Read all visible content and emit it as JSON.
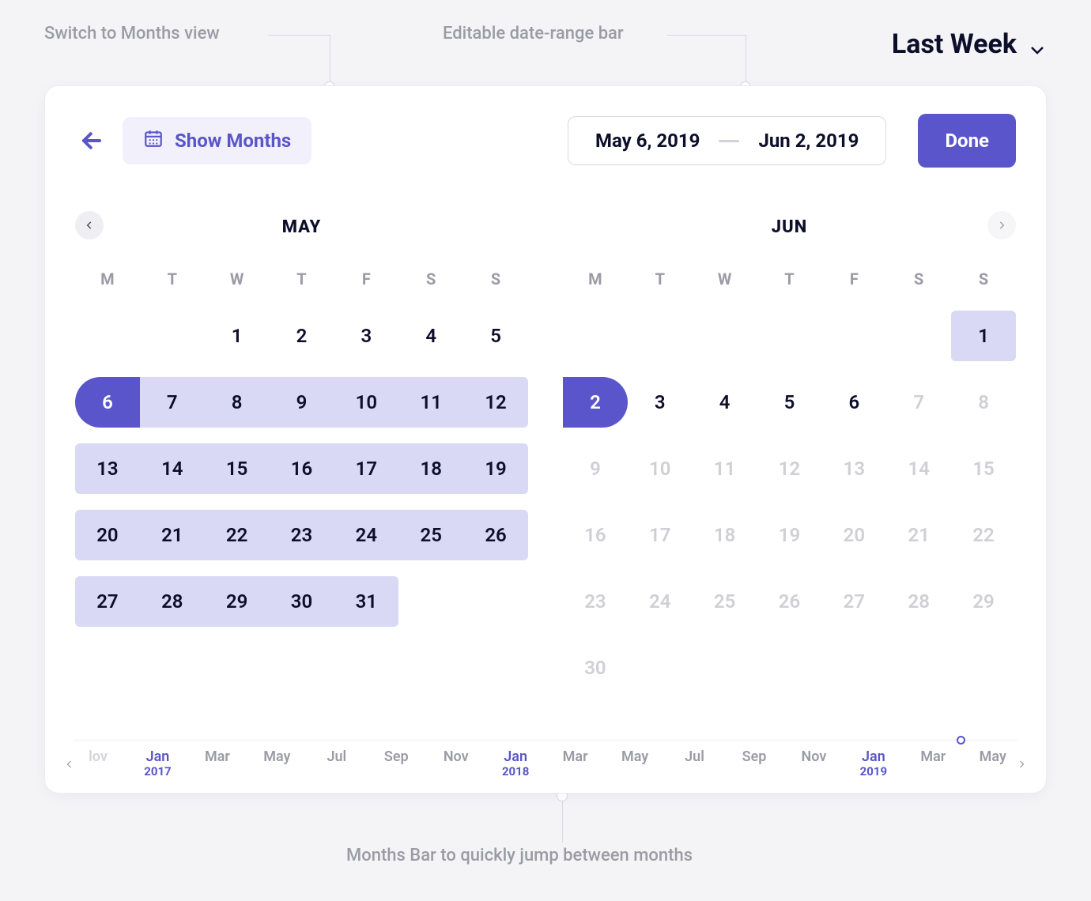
{
  "annotations": {
    "switch": "Switch to Months view",
    "bar": "Editable date-range bar",
    "months": "Months Bar to quickly jump between months"
  },
  "preset": {
    "label": "Last Week"
  },
  "toolbar": {
    "show_months": "Show Months",
    "range_from": "May 6, 2019",
    "range_to": "Jun 2, 2019",
    "done": "Done"
  },
  "weekdays": [
    "M",
    "T",
    "W",
    "T",
    "F",
    "S",
    "S"
  ],
  "selection": {
    "start_iso": "2019-05-06",
    "end_iso": "2019-06-02"
  },
  "months": [
    {
      "key": "may",
      "title": "MAY",
      "nav_prev": true,
      "nav_next": false,
      "days": [
        {
          "t": "empty"
        },
        {
          "t": "empty"
        },
        {
          "t": "n",
          "n": 1
        },
        {
          "t": "n",
          "n": 2
        },
        {
          "t": "n",
          "n": 3
        },
        {
          "t": "n",
          "n": 4
        },
        {
          "t": "n",
          "n": 5
        },
        {
          "t": "n",
          "n": 6,
          "sel": true,
          "cap": "start",
          "row_start": true
        },
        {
          "t": "n",
          "n": 7,
          "sel": true
        },
        {
          "t": "n",
          "n": 8,
          "sel": true
        },
        {
          "t": "n",
          "n": 9,
          "sel": true
        },
        {
          "t": "n",
          "n": 10,
          "sel": true
        },
        {
          "t": "n",
          "n": 11,
          "sel": true
        },
        {
          "t": "n",
          "n": 12,
          "sel": true,
          "row_end": true
        },
        {
          "t": "n",
          "n": 13,
          "sel": true,
          "row_start": true
        },
        {
          "t": "n",
          "n": 14,
          "sel": true
        },
        {
          "t": "n",
          "n": 15,
          "sel": true
        },
        {
          "t": "n",
          "n": 16,
          "sel": true
        },
        {
          "t": "n",
          "n": 17,
          "sel": true
        },
        {
          "t": "n",
          "n": 18,
          "sel": true
        },
        {
          "t": "n",
          "n": 19,
          "sel": true,
          "row_end": true
        },
        {
          "t": "n",
          "n": 20,
          "sel": true,
          "row_start": true
        },
        {
          "t": "n",
          "n": 21,
          "sel": true
        },
        {
          "t": "n",
          "n": 22,
          "sel": true
        },
        {
          "t": "n",
          "n": 23,
          "sel": true
        },
        {
          "t": "n",
          "n": 24,
          "sel": true
        },
        {
          "t": "n",
          "n": 25,
          "sel": true
        },
        {
          "t": "n",
          "n": 26,
          "sel": true,
          "row_end": true
        },
        {
          "t": "n",
          "n": 27,
          "sel": true,
          "row_start": true
        },
        {
          "t": "n",
          "n": 28,
          "sel": true
        },
        {
          "t": "n",
          "n": 29,
          "sel": true
        },
        {
          "t": "n",
          "n": 30,
          "sel": true
        },
        {
          "t": "n",
          "n": 31,
          "sel": true,
          "row_end": true
        },
        {
          "t": "empty"
        },
        {
          "t": "empty"
        }
      ]
    },
    {
      "key": "jun",
      "title": "JUN",
      "nav_prev": false,
      "nav_next": true,
      "days": [
        {
          "t": "empty"
        },
        {
          "t": "empty"
        },
        {
          "t": "empty"
        },
        {
          "t": "empty"
        },
        {
          "t": "empty"
        },
        {
          "t": "empty"
        },
        {
          "t": "n",
          "n": 1,
          "sel": true,
          "row_start": true,
          "row_end": true
        },
        {
          "t": "n",
          "n": 2,
          "sel": true,
          "cap": "end",
          "row_start": true,
          "row_end": true
        },
        {
          "t": "n",
          "n": 3
        },
        {
          "t": "n",
          "n": 4
        },
        {
          "t": "n",
          "n": 5
        },
        {
          "t": "n",
          "n": 6
        },
        {
          "t": "out",
          "n": 7
        },
        {
          "t": "out",
          "n": 8
        },
        {
          "t": "out",
          "n": 9
        },
        {
          "t": "out",
          "n": 10
        },
        {
          "t": "out",
          "n": 11
        },
        {
          "t": "out",
          "n": 12
        },
        {
          "t": "out",
          "n": 13
        },
        {
          "t": "out",
          "n": 14
        },
        {
          "t": "out",
          "n": 15
        },
        {
          "t": "out",
          "n": 16
        },
        {
          "t": "out",
          "n": 17
        },
        {
          "t": "out",
          "n": 18
        },
        {
          "t": "out",
          "n": 19
        },
        {
          "t": "out",
          "n": 20
        },
        {
          "t": "out",
          "n": 21
        },
        {
          "t": "out",
          "n": 22
        },
        {
          "t": "out",
          "n": 23
        },
        {
          "t": "out",
          "n": 24
        },
        {
          "t": "out",
          "n": 25
        },
        {
          "t": "out",
          "n": 26
        },
        {
          "t": "out",
          "n": 27
        },
        {
          "t": "out",
          "n": 28
        },
        {
          "t": "out",
          "n": 29
        },
        {
          "t": "out",
          "n": 30
        },
        {
          "t": "empty"
        },
        {
          "t": "empty"
        },
        {
          "t": "empty"
        },
        {
          "t": "empty"
        },
        {
          "t": "empty"
        },
        {
          "t": "empty"
        }
      ]
    }
  ],
  "timeline": [
    {
      "m": "lov",
      "edge": true
    },
    {
      "m": "Jan",
      "y": "2017",
      "jan": true
    },
    {
      "m": "Mar"
    },
    {
      "m": "May"
    },
    {
      "m": "Jul"
    },
    {
      "m": "Sep"
    },
    {
      "m": "Nov"
    },
    {
      "m": "Jan",
      "y": "2018",
      "jan": true
    },
    {
      "m": "Mar"
    },
    {
      "m": "May"
    },
    {
      "m": "Jul"
    },
    {
      "m": "Sep"
    },
    {
      "m": "Nov"
    },
    {
      "m": "Jan",
      "y": "2019",
      "jan": true
    },
    {
      "m": "Mar"
    },
    {
      "m": "May"
    }
  ]
}
